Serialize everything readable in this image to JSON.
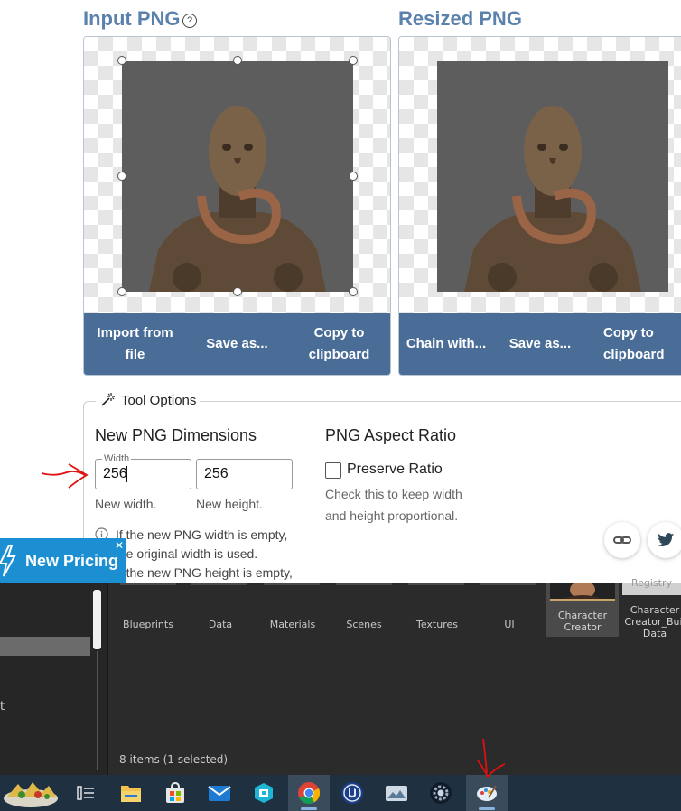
{
  "input_panel": {
    "title": "Input PNG",
    "help_icon": "?",
    "buttons": [
      {
        "line1": "Import from",
        "line2": "file"
      },
      {
        "line1": "Save as...",
        "line2": ""
      },
      {
        "line1": "Copy to",
        "line2": "clipboard"
      }
    ]
  },
  "resized_panel": {
    "title": "Resized PNG",
    "buttons": [
      {
        "line1": "Chain with...",
        "line2": ""
      },
      {
        "line1": "Save as...",
        "line2": ""
      },
      {
        "line1": "Copy to",
        "line2": "clipboard"
      }
    ]
  },
  "tool_options": {
    "title": "Tool Options",
    "dimensions": {
      "heading": "New PNG Dimensions",
      "width_legend": "Width",
      "width_value": "256",
      "height_value": "256",
      "width_hint": "New width.",
      "height_hint": "New height.",
      "info_line1": "If the new PNG width is empty,",
      "info_line2": "the original width is used.",
      "info_line3": "If the new PNG height is empty,"
    },
    "aspect": {
      "heading": "PNG Aspect Ratio",
      "checkbox_label": "Preserve Ratio",
      "checked": false,
      "help_line1": "Check this to keep width",
      "help_line2": "and height proportional."
    }
  },
  "pricing_banner": {
    "label": "New Pricing",
    "close": "✕"
  },
  "content_browser": {
    "folders": [
      "Blueprints",
      "Data",
      "Materials",
      "Scenes",
      "Textures",
      "UI"
    ],
    "assets": [
      {
        "line1": "Character",
        "line2": "Creator",
        "line3": ""
      },
      {
        "line1": "Character",
        "line2": "Creator_Buil",
        "line3": "Data"
      }
    ],
    "tile_partial_text": "Registry",
    "left_partial_text": "t",
    "items_count": "8 items (1 selected)"
  },
  "taskbar": {
    "icons": [
      "widget-icon",
      "task-view-icon",
      "file-explorer-icon",
      "store-icon",
      "mail-icon",
      "vpn-icon",
      "chrome-icon",
      "unreal-icon",
      "photos-icon",
      "settings-gear-icon",
      "paint-icon"
    ]
  },
  "colors": {
    "panel_title": "#5b82ad",
    "button_bar": "#496d96",
    "pricing": "#1b8fd1",
    "taskbar": "#1f3040",
    "annotation": "#e01010"
  }
}
